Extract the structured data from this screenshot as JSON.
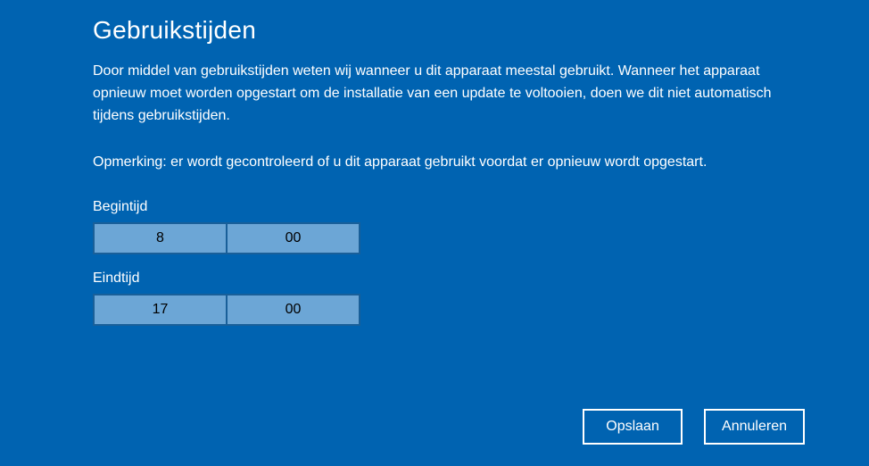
{
  "title": "Gebruikstijden",
  "description": "Door middel van gebruikstijden weten wij wanneer u dit apparaat meestal gebruikt. Wanneer het apparaat opnieuw moet worden opgestart om de installatie van een update te voltooien, doen we dit niet automatisch tijdens gebruikstijden.",
  "note": "Opmerking: er wordt gecontroleerd of u dit apparaat gebruikt voordat er opnieuw wordt opgestart.",
  "start": {
    "label": "Begintijd",
    "hour": "8",
    "minute": "00"
  },
  "end": {
    "label": "Eindtijd",
    "hour": "17",
    "minute": "00"
  },
  "buttons": {
    "save": "Opslaan",
    "cancel": "Annuleren"
  }
}
